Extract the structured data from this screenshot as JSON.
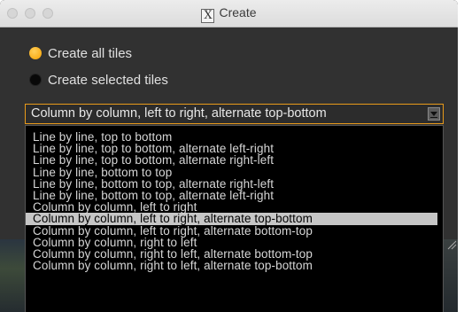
{
  "window": {
    "title": "Create",
    "title_icon": "x11-icon"
  },
  "options": {
    "create_all": {
      "label": "Create all tiles",
      "selected": true
    },
    "create_selected": {
      "label": "Create selected tiles",
      "selected": false
    }
  },
  "order_select": {
    "value": "Column by column, left to right, alternate top-bottom",
    "items": [
      "Line by line, top to bottom",
      "Line by line, top to bottom, alternate left-right",
      "Line by line, top to bottom, alternate right-left",
      "Line by line, bottom to top",
      "Line by line, bottom to top, alternate right-left",
      "Line by line, bottom to top, alternate left-right",
      "Column by column, left to right",
      "Column by column, left to right, alternate top-bottom",
      "Column by column, left to right, alternate bottom-top",
      "Column by column, right to left",
      "Column by column, right to left, alternate bottom-top",
      "Column by column, right to left, alternate top-bottom"
    ],
    "highlighted_index": 7
  },
  "colors": {
    "accent": "#f5a000",
    "window_bg": "#313131",
    "list_bg": "#000000",
    "highlight": "#c6c6c6"
  }
}
